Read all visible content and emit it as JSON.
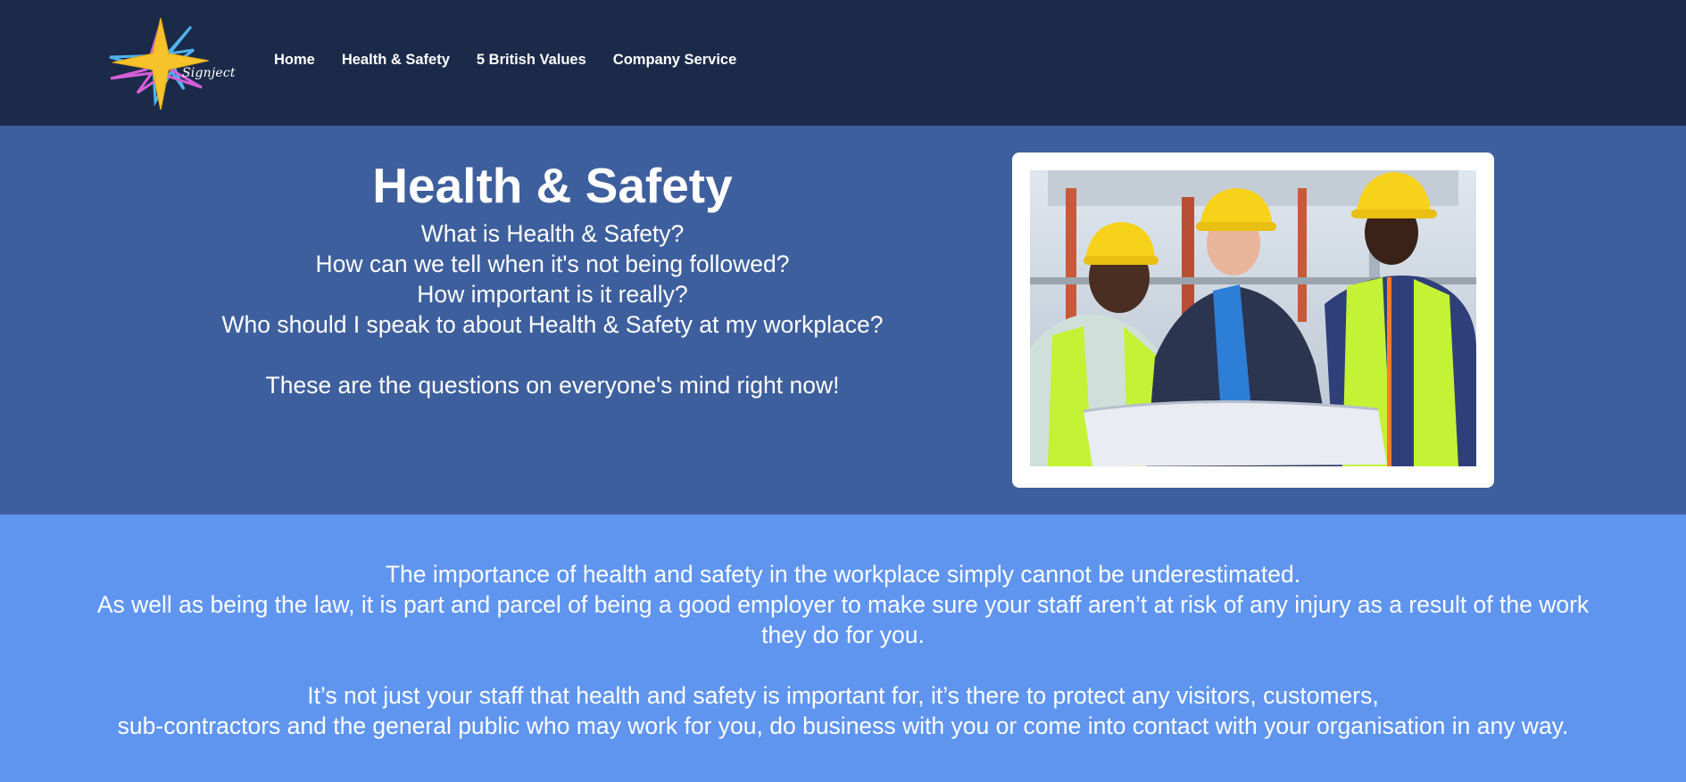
{
  "brand": {
    "logo_text": "Signject",
    "logo_colors": {
      "star": "#f7c32a",
      "blue": "#4fb4ef",
      "pink": "#d75fd8"
    }
  },
  "nav": {
    "items": [
      {
        "label": "Home"
      },
      {
        "label": "Health & Safety"
      },
      {
        "label": "5 British Values"
      },
      {
        "label": "Company Service"
      }
    ]
  },
  "hero": {
    "title": "Health & Safety",
    "questions": [
      "What is Health & Safety?",
      "How can we tell when it's not being followed?",
      "How important is it really?",
      "Who should I speak to about Health & Safety at my workplace?"
    ],
    "tagline": "These are the questions on everyone's mind right now!",
    "image_alt": "workers-in-hard-hats-reviewing-plans"
  },
  "info": {
    "lines": [
      "The importance of health and safety in the workplace simply cannot be underestimated.",
      "As well as being the law, it is part and parcel of being a good employer to make sure your staff aren’t at risk of any injury as a result of the work",
      "they do for you.",
      "It’s not just your staff that health and safety is important for, it’s there to protect any visitors, customers,",
      "sub-contractors and the general public who may work for you, do business with you or come into contact with your organisation in any way."
    ]
  },
  "colors": {
    "navbar_bg": "#1c2a4a",
    "hero_bg": "#3e5f9d",
    "info_bg": "#5f95ef"
  }
}
